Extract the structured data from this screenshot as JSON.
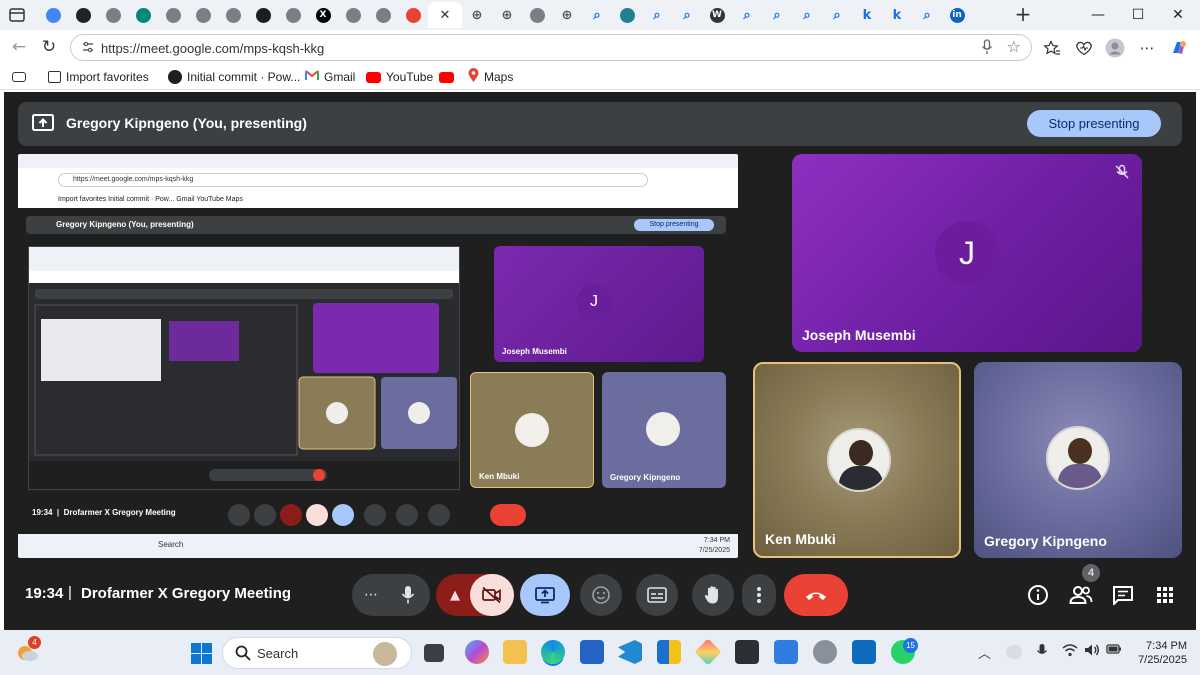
{
  "browser": {
    "url": "https://meet.google.com/mps-kqsh-kkg",
    "tab_icons": [
      "google-icon",
      "chatgpt-icon",
      "tab-icon",
      "meet-icon",
      "tab-icon",
      "tab-icon",
      "tab-icon",
      "github-icon",
      "tab-icon",
      "x-icon",
      "tab-icon",
      "tab-icon",
      "gmail-icon",
      "active-tab",
      "globe-icon",
      "globe-icon",
      "tab-icon",
      "globe-icon",
      "search-icon",
      "perplexity-icon",
      "search-icon",
      "search-icon",
      "wikipedia-icon",
      "search-icon",
      "search-icon",
      "search-icon",
      "search-icon",
      "k-icon",
      "k-icon",
      "search-icon",
      "linkedin-icon"
    ],
    "active_tab_close": "✕",
    "new_tab": "+",
    "window_controls": [
      "—",
      "☐",
      "✕"
    ]
  },
  "bookmarks": [
    {
      "label": "Import favorites",
      "icon": "import-icon"
    },
    {
      "label": "Initial commit · Pow...",
      "icon": "github-icon"
    },
    {
      "label": "Gmail",
      "icon": "gmail-icon"
    },
    {
      "label": "YouTube",
      "icon": "youtube-icon"
    },
    {
      "label": "",
      "icon": "youtube-icon"
    },
    {
      "label": "Maps",
      "icon": "maps-icon"
    }
  ],
  "meet": {
    "presenter_text": "Gregory Kipngeno (You, presenting)",
    "stop_presenting": "Stop presenting",
    "participants": [
      {
        "name": "Joseph Musembi",
        "initial": "J",
        "muted": true
      },
      {
        "name": "Ken Mbuki"
      },
      {
        "name": "Gregory Kipngeno"
      }
    ],
    "time": "19:34",
    "separator": "|",
    "meeting_title": "Drofarmer X Gregory Meeting",
    "participant_count": "4"
  },
  "preview": {
    "url": "https://meet.google.com/mps-kqsh-kkg",
    "bookmarks_text": "Import favorites   Initial commit · Pow...   Gmail   YouTube   Maps",
    "presenter_text": "Gregory Kipngeno (You, presenting)",
    "stop_presenting": "Stop presenting",
    "joseph_initial": "J",
    "joseph_name": "Joseph Musembi",
    "ken_name": "Ken Mbuki",
    "greg_name": "Gregory Kipngeno",
    "time": "19:34",
    "meeting_title": "Drofarmer X Gregory Meeting",
    "taskbar_search": "Search",
    "clock_time": "7:34 PM",
    "clock_date": "7/25/2025"
  },
  "taskbar": {
    "weather_badge": "4",
    "search_placeholder": "Search",
    "outlook_badge": "",
    "whatsapp_badge": "15",
    "time": "7:34 PM",
    "date": "7/25/2025"
  },
  "colors": {
    "meet_bg": "#1f1f20",
    "bar_bg": "#3c4043",
    "stop_btn": "#a8c7fa",
    "end_call": "#ea4335",
    "joseph_tile": "#7b28b3",
    "speaking_border": "#e8c17a"
  }
}
